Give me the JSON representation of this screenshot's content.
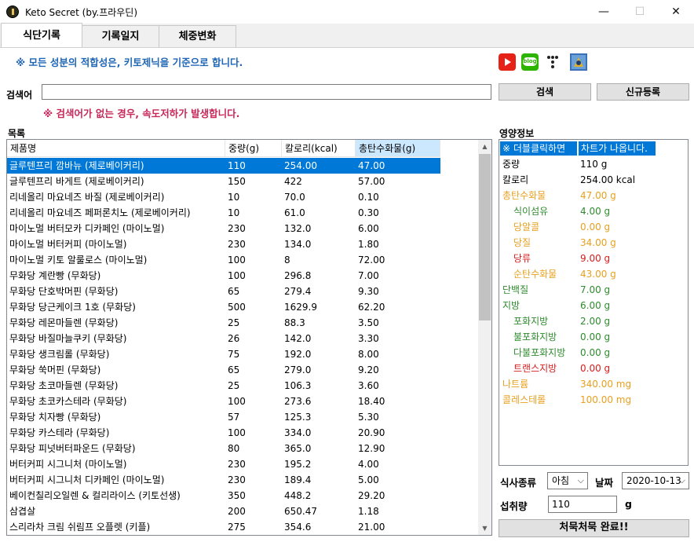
{
  "window": {
    "title": "Keto Secret (by.프라우딘)",
    "minimize": "—",
    "maximize": "☐",
    "close": "✕"
  },
  "tabs": [
    {
      "label": "식단기록"
    },
    {
      "label": "기록일지"
    },
    {
      "label": "체중변화"
    }
  ],
  "notice": "※ 모든 성분의 적합성은, 키토제닉을 기준으로 합니다.",
  "social": [
    {
      "name": "youtube-icon",
      "color": "#e62117"
    },
    {
      "name": "blog-icon",
      "color": "#2db400",
      "text": "blog"
    },
    {
      "name": "tistory-icon",
      "color": "#ffffff"
    },
    {
      "name": "cafe-icon",
      "color": "#3b6fb6"
    }
  ],
  "search": {
    "label": "검색어",
    "value": "",
    "button": "검색",
    "register_button": "신규등록",
    "warning": "※ 검색어가 없는 경우, 속도저하가 발생합니다."
  },
  "list": {
    "label": "목록",
    "columns": [
      "제품명",
      "중량(g)",
      "칼로리(kcal)",
      "총탄수화물(g)"
    ],
    "rows": [
      [
        "글루텐프리 깜바뉴 (제로베이커리)",
        "110",
        "254.00",
        "47.00"
      ],
      [
        "글루텐프리 바게트 (제로베이커리)",
        "150",
        "422",
        "57.00"
      ],
      [
        "리네올리 마요네즈 바질 (제로베이커리)",
        "10",
        "70.0",
        "0.10"
      ],
      [
        "리네올리 마요네즈 페퍼론치노 (제로베이커리)",
        "10",
        "61.0",
        "0.30"
      ],
      [
        "마이노멀 버터모카 디카페인 (마이노멀)",
        "230",
        "132.0",
        "6.00"
      ],
      [
        "마이노멀 버터커피 (마이노멀)",
        "230",
        "134.0",
        "1.80"
      ],
      [
        "마이노멀 키토 알룰로스 (마이노멀)",
        "100",
        "8",
        "72.00"
      ],
      [
        "무화당 계란빵 (무화당)",
        "100",
        "296.8",
        "7.00"
      ],
      [
        "무화당 단호박머핀 (무화당)",
        "65",
        "279.4",
        "9.30"
      ],
      [
        "무화당 당근케이크 1호 (무화당)",
        "500",
        "1629.9",
        "62.20"
      ],
      [
        "무화당 레몬마들렌 (무화당)",
        "25",
        "88.3",
        "3.50"
      ],
      [
        "무화당 바질마늘쿠키 (무화당)",
        "26",
        "142.0",
        "3.30"
      ],
      [
        "무화당 생크림롤 (무화당)",
        "75",
        "192.0",
        "8.00"
      ],
      [
        "무화당 쑥머핀 (무화당)",
        "65",
        "279.0",
        "9.20"
      ],
      [
        "무화당 초코마들렌 (무화당)",
        "25",
        "106.3",
        "3.60"
      ],
      [
        "무화당 초코카스테라 (무화당)",
        "100",
        "273.6",
        "18.40"
      ],
      [
        "무화당 치자빵 (무화당)",
        "57",
        "125.3",
        "5.30"
      ],
      [
        "무화당 카스테라 (무화당)",
        "100",
        "334.0",
        "20.90"
      ],
      [
        "무화당 피넛버터파운드 (무화당)",
        "80",
        "365.0",
        "12.90"
      ],
      [
        "버터커피 시그니처 (마이노멀)",
        "230",
        "195.2",
        "4.00"
      ],
      [
        "버터커피 시그니처 디카페인 (마이노멀)",
        "230",
        "189.4",
        "5.00"
      ],
      [
        "베이컨칠리오일렌 & 컬리라이스 (키토선생)",
        "350",
        "448.2",
        "29.20"
      ],
      [
        "삼겹살",
        "200",
        "650.47",
        "1.18"
      ],
      [
        "스리라차 크림 쉬림프 오플렛 (키플)",
        "275",
        "354.6",
        "21.00"
      ]
    ]
  },
  "nutrition": {
    "label": "영양정보",
    "header": [
      "※ 더블클릭하면",
      "차트가 나옵니다."
    ],
    "rows": [
      {
        "k": "중량",
        "v": "110 g",
        "color": "#000000",
        "indent": 0
      },
      {
        "k": "칼로리",
        "v": "254.00 kcal",
        "color": "#000000",
        "indent": 0
      },
      {
        "k": "총탄수화물",
        "v": "47.00 g",
        "color": "#e8a020",
        "indent": 0
      },
      {
        "k": "식이섬유",
        "v": "4.00 g",
        "color": "#2e8b2e",
        "indent": 2
      },
      {
        "k": "당알콜",
        "v": "0.00 g",
        "color": "#e8a020",
        "indent": 2
      },
      {
        "k": "당질",
        "v": "34.00 g",
        "color": "#e8a020",
        "indent": 2
      },
      {
        "k": "당류",
        "v": "9.00 g",
        "color": "#d61c1c",
        "indent": 2
      },
      {
        "k": "순탄수화물",
        "v": "43.00 g",
        "color": "#e8a020",
        "indent": 2
      },
      {
        "k": "단백질",
        "v": "7.00 g",
        "color": "#2e8b2e",
        "indent": 0
      },
      {
        "k": "지방",
        "v": "6.00 g",
        "color": "#2e8b2e",
        "indent": 0
      },
      {
        "k": "포화지방",
        "v": "2.00 g",
        "color": "#2e8b2e",
        "indent": 2
      },
      {
        "k": "불포화지방",
        "v": "0.00 g",
        "color": "#2e8b2e",
        "indent": 2
      },
      {
        "k": "다불포화지방",
        "v": "0.00 g",
        "color": "#2e8b2e",
        "indent": 2
      },
      {
        "k": "트랜스지방",
        "v": "0.00 g",
        "color": "#d61c1c",
        "indent": 2
      },
      {
        "k": "나트륨",
        "v": "340.00 mg",
        "color": "#e8a020",
        "indent": 0
      },
      {
        "k": "콜레스테롤",
        "v": "100.00 mg",
        "color": "#e8a020",
        "indent": 0
      }
    ]
  },
  "meal": {
    "type_label": "식사종류",
    "type_value": "아침",
    "date_label": "날짜",
    "date_value": "2020-10-13",
    "intake_label": "섭취량",
    "intake_value": "110",
    "intake_unit": "g",
    "done_button": "처묵처묵 완료!!"
  }
}
